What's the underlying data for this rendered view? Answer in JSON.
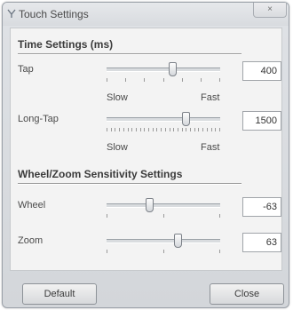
{
  "window": {
    "title": "Touch Settings",
    "close_glyph": "×"
  },
  "time_settings": {
    "title": "Time Settings (ms)",
    "rows": [
      {
        "label": "Tap",
        "value": "400",
        "slider_position": 0.58,
        "scale_low": "Slow",
        "scale_high": "Fast"
      },
      {
        "label": "Long-Tap",
        "value": "1500",
        "slider_position": 0.7,
        "scale_low": "Slow",
        "scale_high": "Fast"
      }
    ]
  },
  "wheel_zoom": {
    "title": "Wheel/Zoom Sensitivity Settings",
    "rows": [
      {
        "label": "Wheel",
        "value": "-63",
        "slider_position": 0.38
      },
      {
        "label": "Zoom",
        "value": "63",
        "slider_position": 0.63
      }
    ]
  },
  "buttons": {
    "default": "Default",
    "close": "Close"
  },
  "icons": {
    "title": "touch-icon"
  }
}
